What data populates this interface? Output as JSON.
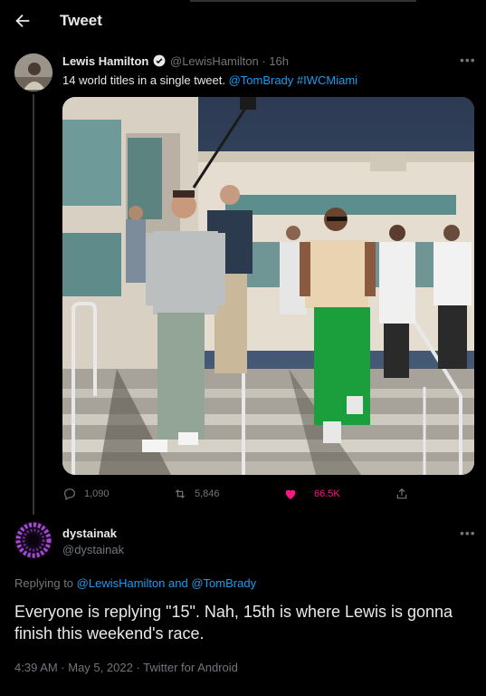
{
  "header": {
    "title": "Tweet",
    "back_icon": "arrow-left-icon"
  },
  "tweet": {
    "author_name": "Lewis Hamilton",
    "author_handle": "@LewisHamilton",
    "time": "16h",
    "separator": "·",
    "text": "14 world titles in a single tweet.",
    "mention": "@TomBrady",
    "hashtag": "#IWCMiami",
    "stats": {
      "replies": "1,090",
      "retweets": "5,846",
      "likes": "66.5K"
    }
  },
  "reply": {
    "author_name": "dystainak",
    "author_handle": "@dystainak",
    "replying_prefix": "Replying to",
    "replying_to_1": "@LewisHamilton",
    "replying_and": "and",
    "replying_to_2": "@TomBrady",
    "text": "Everyone is replying \"15\". Nah, 15th is where Lewis is gonna finish this weekend's race.",
    "timestamp": "4:39 AM · May 5, 2022 · Twitter for Android"
  },
  "colors": {
    "background": "#000000",
    "link": "#1d9bf0",
    "like": "#f91880",
    "muted": "#71767b"
  }
}
